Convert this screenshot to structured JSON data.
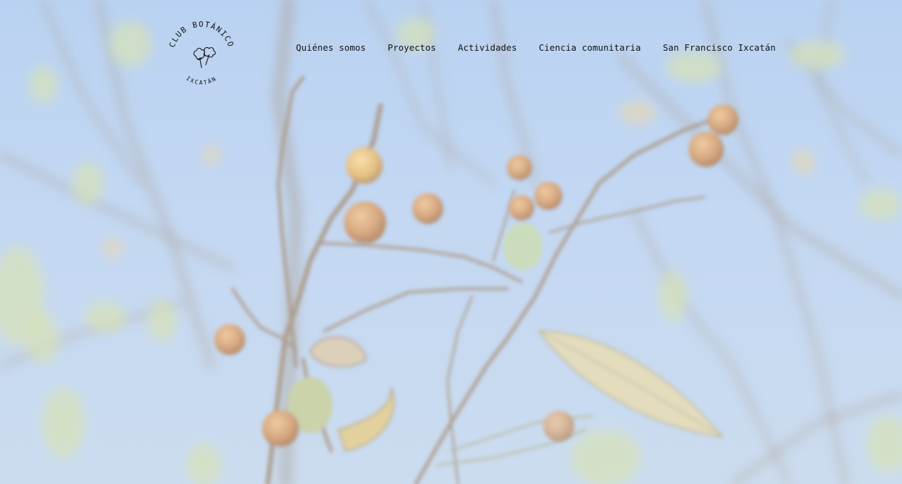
{
  "brand": {
    "logo_top_text": "CLUB BOTÁNICO",
    "logo_bottom_text": "IXCATÁN"
  },
  "nav": {
    "items": [
      {
        "label": "Quiénes somos"
      },
      {
        "label": "Proyectos"
      },
      {
        "label": "Actividades"
      },
      {
        "label": "Ciencia comunitaria"
      },
      {
        "label": "San Francisco Ixcatán"
      }
    ]
  },
  "colors": {
    "sky": "#a9c6ee",
    "fruit": "#c98a52",
    "nav_text": "#111111"
  }
}
